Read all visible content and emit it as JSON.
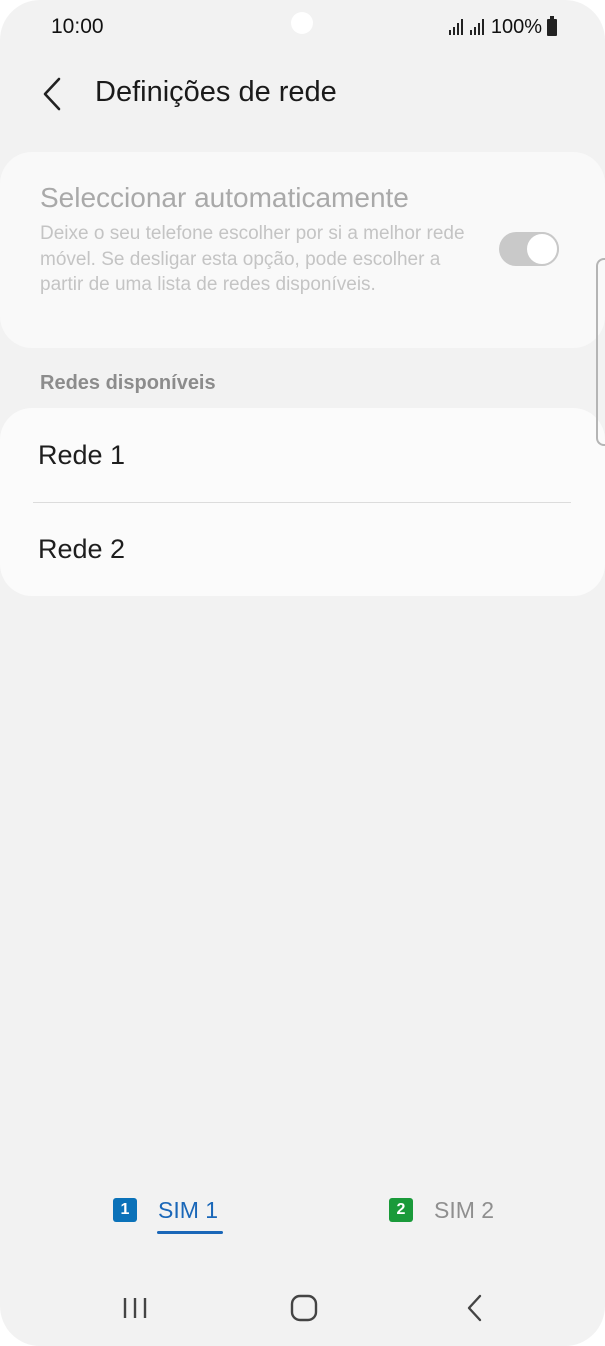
{
  "status_bar": {
    "time": "10:00",
    "battery": "100%"
  },
  "header": {
    "title": "Definições de rede",
    "back_icon": "chevron-left-icon"
  },
  "auto_select": {
    "title": "Seleccionar automaticamente",
    "description": "Deixe o seu telefone escolher por si a melhor rede móvel. Se desligar esta opção, pode escolher a partir de uma lista de redes disponíveis.",
    "enabled": true,
    "disabled_look": true
  },
  "networks": {
    "section_label": "Redes disponíveis",
    "items": [
      {
        "label": "Rede 1"
      },
      {
        "label": "Rede 2"
      }
    ]
  },
  "sim_tabs": [
    {
      "badge": "1",
      "label": "SIM 1",
      "selected": true,
      "color": "#0b72b9"
    },
    {
      "badge": "2",
      "label": "SIM 2",
      "selected": false,
      "color": "#1a9a3a"
    }
  ],
  "nav": {
    "recents_icon": "recents-icon",
    "home_icon": "home-icon",
    "back_icon": "back-icon"
  }
}
